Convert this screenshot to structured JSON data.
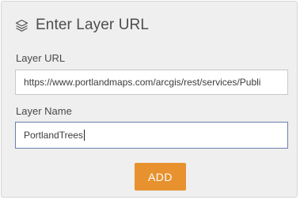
{
  "header": {
    "icon": "layers-icon",
    "title": "Enter Layer URL"
  },
  "fields": {
    "url": {
      "label": "Layer URL",
      "value": "https://www.portlandmaps.com/arcgis/rest/services/Publi"
    },
    "name": {
      "label": "Layer Name",
      "value": "PortlandTrees"
    }
  },
  "actions": {
    "add_label": "ADD"
  },
  "colors": {
    "panel_bg": "#efefef",
    "accent": "#e8912f",
    "focus_border": "#6a7fa8"
  }
}
